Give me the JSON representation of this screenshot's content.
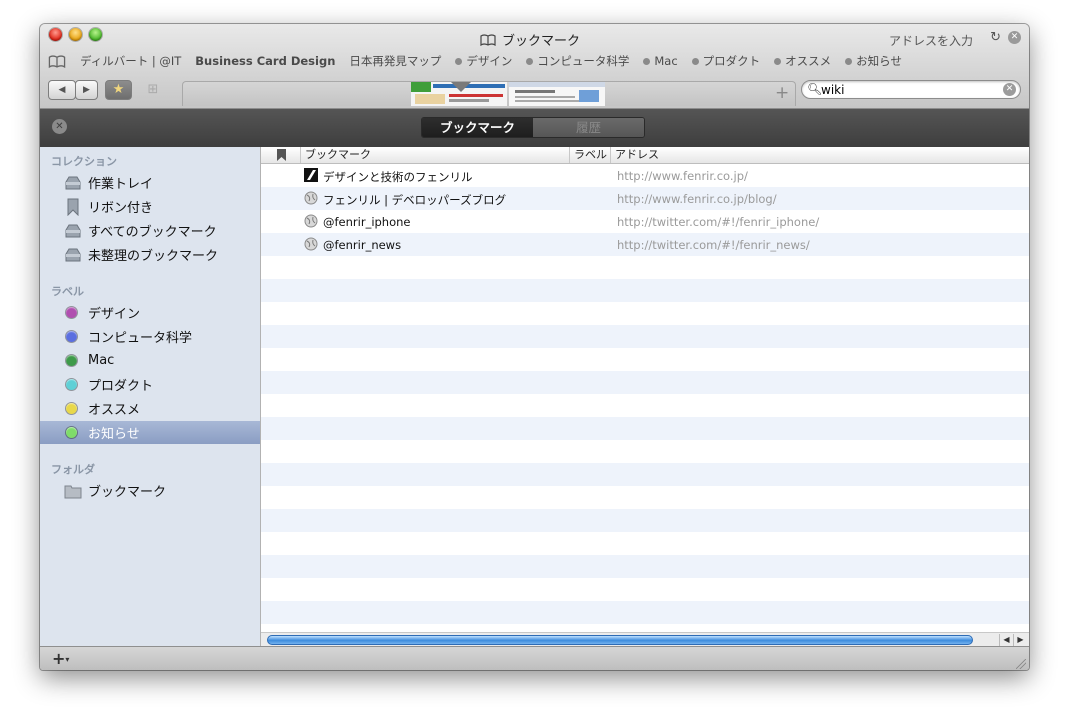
{
  "window": {
    "title": "ブックマーク",
    "address_label": "アドレスを入力"
  },
  "bookmarks_bar": [
    {
      "label": "ディルバート | @IT",
      "dot": false
    },
    {
      "label": "Business Card Design",
      "dot": false
    },
    {
      "label": "日本再発見マップ",
      "dot": false
    },
    {
      "label": "デザイン",
      "dot": true
    },
    {
      "label": "コンピュータ科学",
      "dot": true
    },
    {
      "label": "Mac",
      "dot": true
    },
    {
      "label": "プロダクト",
      "dot": true
    },
    {
      "label": "オススメ",
      "dot": true
    },
    {
      "label": "お知らせ",
      "dot": true
    }
  ],
  "search": {
    "value": "wiki",
    "placeholder": ""
  },
  "segments": {
    "active": "ブックマーク",
    "inactive": "履歴"
  },
  "sidebar": {
    "collections_header": "コレクション",
    "collections": [
      {
        "label": "作業トレイ",
        "icon": "tray-icon"
      },
      {
        "label": "リボン付き",
        "icon": "ribbon-icon"
      },
      {
        "label": "すべてのブックマーク",
        "icon": "tray-icon"
      },
      {
        "label": "未整理のブックマーク",
        "icon": "tray-icon"
      }
    ],
    "labels_header": "ラベル",
    "labels": [
      {
        "label": "デザイン",
        "color": "#b04fb0"
      },
      {
        "label": "コンピュータ科学",
        "color": "#5b6fe0"
      },
      {
        "label": "Mac",
        "color": "#3e9a4a"
      },
      {
        "label": "プロダクト",
        "color": "#5fd0d6"
      },
      {
        "label": "オススメ",
        "color": "#e8d84a"
      },
      {
        "label": "お知らせ",
        "color": "#7fdc6a"
      }
    ],
    "selected_label": "お知らせ",
    "folders_header": "フォルダ",
    "folders": [
      {
        "label": "ブックマーク",
        "icon": "folder-icon"
      }
    ]
  },
  "table": {
    "columns": {
      "bookmark": "ブックマーク",
      "label": "ラベル",
      "address": "アドレス"
    },
    "rows": [
      {
        "name": "デザインと技術のフェンリル",
        "url": "http://www.fenrir.co.jp/",
        "icon": "fenrir-favicon"
      },
      {
        "name": "フェンリル | デベロッパーズブログ",
        "url": "http://www.fenrir.co.jp/blog/",
        "icon": "globe-icon"
      },
      {
        "name": "@fenrir_iphone",
        "url": "http://twitter.com/#!/fenrir_iphone/",
        "icon": "globe-icon"
      },
      {
        "name": "@fenrir_news",
        "url": "http://twitter.com/#!/fenrir_news/",
        "icon": "globe-icon"
      }
    ]
  },
  "colors": {
    "row_alt": "#eef3fb",
    "selection": "#8a9dc3",
    "dark_bar": "#474747"
  }
}
